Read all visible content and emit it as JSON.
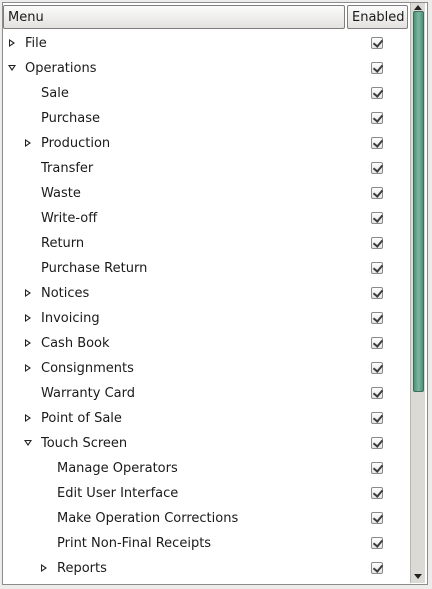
{
  "headers": {
    "menu": "Menu",
    "enabled": "Enabled"
  },
  "rows": [
    {
      "label": "File",
      "level": 0,
      "expander": "collapsed",
      "enabled": true
    },
    {
      "label": "Operations",
      "level": 0,
      "expander": "expanded",
      "enabled": true
    },
    {
      "label": "Sale",
      "level": 1,
      "expander": "none",
      "enabled": true
    },
    {
      "label": "Purchase",
      "level": 1,
      "expander": "none",
      "enabled": true
    },
    {
      "label": "Production",
      "level": 1,
      "expander": "collapsed",
      "enabled": true
    },
    {
      "label": "Transfer",
      "level": 1,
      "expander": "none",
      "enabled": true
    },
    {
      "label": "Waste",
      "level": 1,
      "expander": "none",
      "enabled": true
    },
    {
      "label": "Write-off",
      "level": 1,
      "expander": "none",
      "enabled": true
    },
    {
      "label": "Return",
      "level": 1,
      "expander": "none",
      "enabled": true
    },
    {
      "label": "Purchase Return",
      "level": 1,
      "expander": "none",
      "enabled": true
    },
    {
      "label": "Notices",
      "level": 1,
      "expander": "collapsed",
      "enabled": true
    },
    {
      "label": "Invoicing",
      "level": 1,
      "expander": "collapsed",
      "enabled": true
    },
    {
      "label": "Cash Book",
      "level": 1,
      "expander": "collapsed",
      "enabled": true
    },
    {
      "label": "Consignments",
      "level": 1,
      "expander": "collapsed",
      "enabled": true
    },
    {
      "label": "Warranty Card",
      "level": 1,
      "expander": "none",
      "enabled": true
    },
    {
      "label": "Point of Sale",
      "level": 1,
      "expander": "collapsed",
      "enabled": true
    },
    {
      "label": "Touch Screen",
      "level": 1,
      "expander": "expanded",
      "enabled": true
    },
    {
      "label": "Manage Operators",
      "level": 2,
      "expander": "none",
      "enabled": true
    },
    {
      "label": "Edit User Interface",
      "level": 2,
      "expander": "none",
      "enabled": true
    },
    {
      "label": "Make Operation Corrections",
      "level": 2,
      "expander": "none",
      "enabled": true
    },
    {
      "label": "Print Non-Final Receipts",
      "level": 2,
      "expander": "none",
      "enabled": true
    },
    {
      "label": "Reports",
      "level": 2,
      "expander": "collapsed",
      "enabled": true
    }
  ],
  "scrollbar": {
    "position_fraction": 0.0,
    "visible_fraction": 0.68,
    "accent": "#5f9e86"
  },
  "icons": {
    "collapsed": "expander-collapsed-icon",
    "expanded": "expander-expanded-icon",
    "checked": "checkbox-checked-icon"
  }
}
